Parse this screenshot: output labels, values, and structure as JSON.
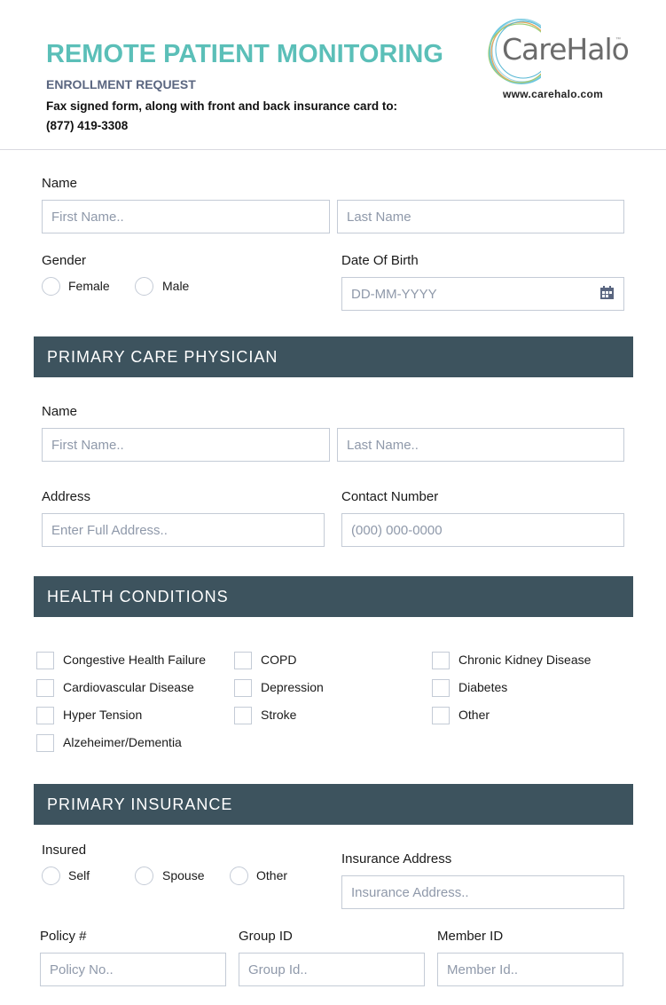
{
  "header": {
    "title": "REMOTE PATIENT MONITORING",
    "subtitle": "ENROLLMENT REQUEST",
    "fax_instructions": "Fax signed form, along with front and back insurance card to:",
    "fax_number": "(877) 419-3308",
    "brand_color": "#5bbfb8"
  },
  "logo": {
    "name": "CareHalo",
    "trademark": "™",
    "website": "www.carehalo.com"
  },
  "patient": {
    "name_label": "Name",
    "first_name_placeholder": "First Name..",
    "last_name_placeholder": "Last Name",
    "gender_label": "Gender",
    "gender_options": [
      "Female",
      "Male"
    ],
    "dob_label": "Date Of Birth",
    "dob_placeholder": "DD-MM-YYYY",
    "dob_icon": "calendar-icon"
  },
  "physician": {
    "section_title": "PRIMARY CARE PHYSICIAN",
    "name_label": "Name",
    "first_name_placeholder": "First Name..",
    "last_name_placeholder": "Last Name..",
    "address_label": "Address",
    "address_placeholder": "Enter Full Address..",
    "contact_label": "Contact Number",
    "contact_placeholder": "(000) 000-0000"
  },
  "conditions": {
    "section_title": "HEALTH CONDITIONS",
    "items": [
      "Congestive Health Failure",
      "Cardiovascular Disease",
      "Hyper Tension",
      "Alzeheimer/Dementia",
      "COPD",
      "Depression",
      "Stroke",
      "Chronic Kidney Disease",
      "Diabetes",
      "Other"
    ]
  },
  "insurance": {
    "section_title": "PRIMARY INSURANCE",
    "insured_label": "Insured",
    "insured_options": [
      "Self",
      "Spouse",
      "Other"
    ],
    "address_label": "Insurance Address",
    "address_placeholder": "Insurance Address..",
    "policy_label": "Policy #",
    "policy_placeholder": "Policy No..",
    "group_label": "Group ID",
    "group_placeholder": "Group Id..",
    "member_label": "Member ID",
    "member_placeholder": "Member Id.."
  },
  "colors": {
    "section_bar": "#3d535e",
    "input_border": "#c4cbd6",
    "placeholder": "#8f99aa"
  }
}
